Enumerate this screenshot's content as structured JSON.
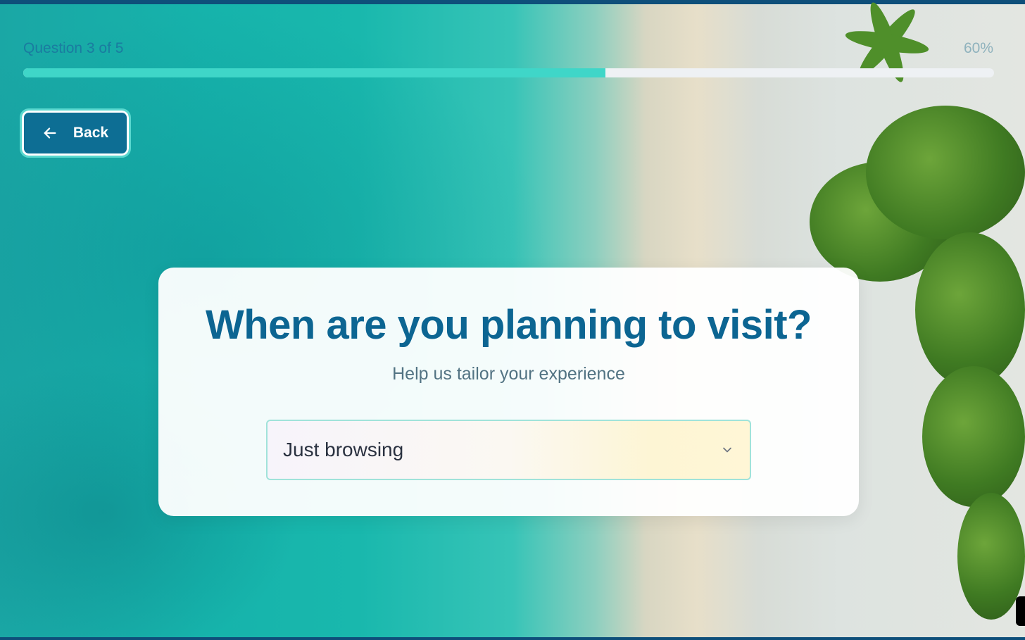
{
  "progress": {
    "label": "Question 3 of 5",
    "percent_text": "60%",
    "fraction": 0.6
  },
  "back_button": {
    "label": "Back",
    "icon": "arrow-left-icon"
  },
  "question": {
    "title": "When are you planning to visit?",
    "subtitle": "Help us tailor your experience"
  },
  "select": {
    "value": "Just browsing",
    "icon": "chevron-down-icon"
  },
  "colors": {
    "primary": "#0d6e94",
    "accent": "#3fd6c8",
    "title": "#0c6592"
  }
}
